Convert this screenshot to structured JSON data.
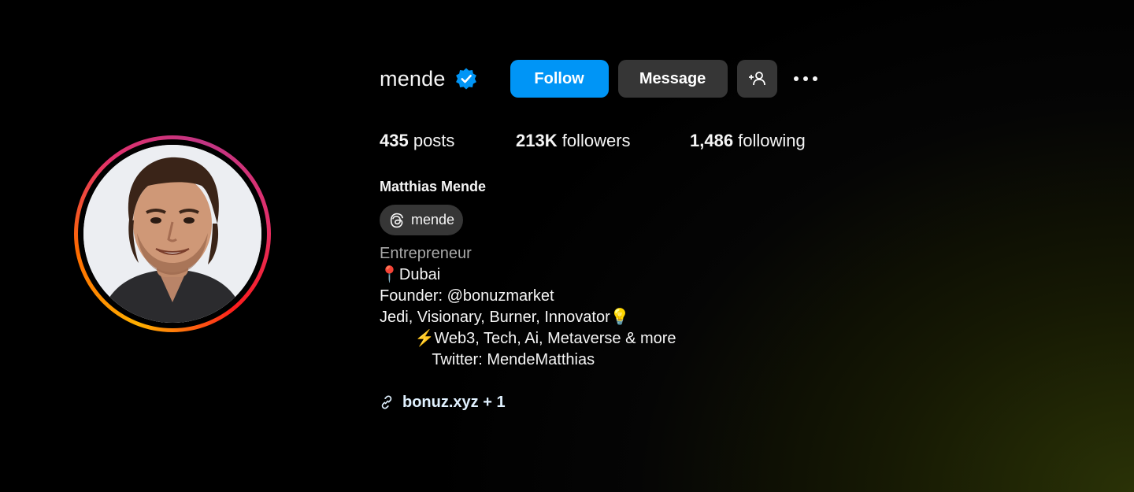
{
  "profile": {
    "username": "mende",
    "verified": true,
    "full_name": "Matthias Mende",
    "threads_handle": "mende",
    "avatar_icon": "profile-photo"
  },
  "actions": {
    "follow_label": "Follow",
    "message_label": "Message",
    "add_user_icon": "add-user-icon",
    "more_icon": "more-options-icon"
  },
  "stats": {
    "posts_count": "435",
    "posts_label": " posts",
    "followers_count": "213K",
    "followers_label": " followers",
    "following_count": "1,486",
    "following_label": " following"
  },
  "bio": {
    "category": "Entrepreneur",
    "lines": [
      "📍Dubai",
      "Founder: @bonuzmarket",
      "Jedi, Visionary, Burner, Innovator💡",
      "        ⚡Web3, Tech, Ai, Metaverse & more",
      "            Twitter: MendeMatthias"
    ]
  },
  "link": {
    "text": "bonuz.xyz + 1",
    "icon": "link-icon"
  },
  "colors": {
    "follow_button": "#0095f6",
    "secondary_button": "#363636",
    "verified_badge": "#0095f6",
    "category_text": "#a8a8a8",
    "link_text": "#e0f1ff",
    "background": "#000000"
  }
}
